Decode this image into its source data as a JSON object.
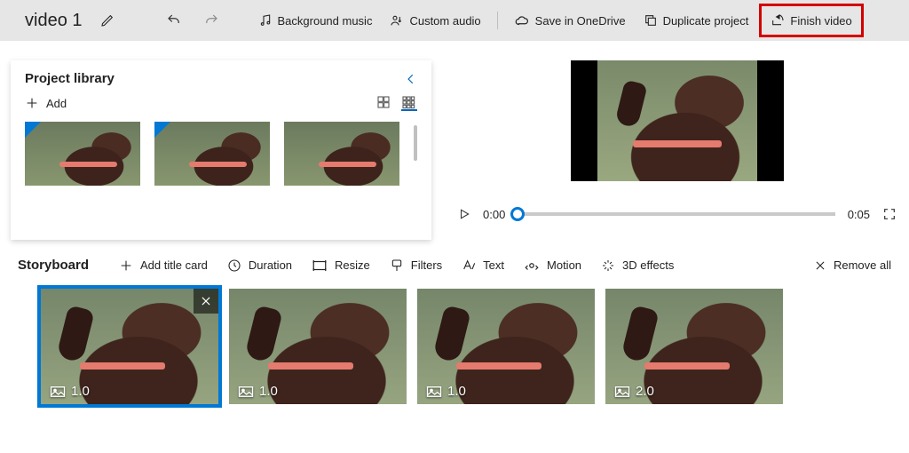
{
  "project_title": "video 1",
  "toolbar": {
    "bg_music": "Background music",
    "custom_audio": "Custom audio",
    "save_onedrive": "Save in OneDrive",
    "duplicate": "Duplicate project",
    "finish": "Finish video"
  },
  "library": {
    "title": "Project library",
    "add_label": "Add",
    "thumbs": [
      1,
      2,
      3
    ]
  },
  "preview": {
    "current_time": "0:00",
    "total_time": "0:05"
  },
  "storyboard": {
    "title": "Storyboard",
    "add_title_card": "Add title card",
    "duration": "Duration",
    "resize": "Resize",
    "filters": "Filters",
    "text": "Text",
    "motion": "Motion",
    "effects3d": "3D effects",
    "remove_all": "Remove all",
    "clips": [
      {
        "duration": "1.0",
        "selected": true
      },
      {
        "duration": "1.0",
        "selected": false
      },
      {
        "duration": "1.0",
        "selected": false
      },
      {
        "duration": "2.0",
        "selected": false
      }
    ]
  }
}
